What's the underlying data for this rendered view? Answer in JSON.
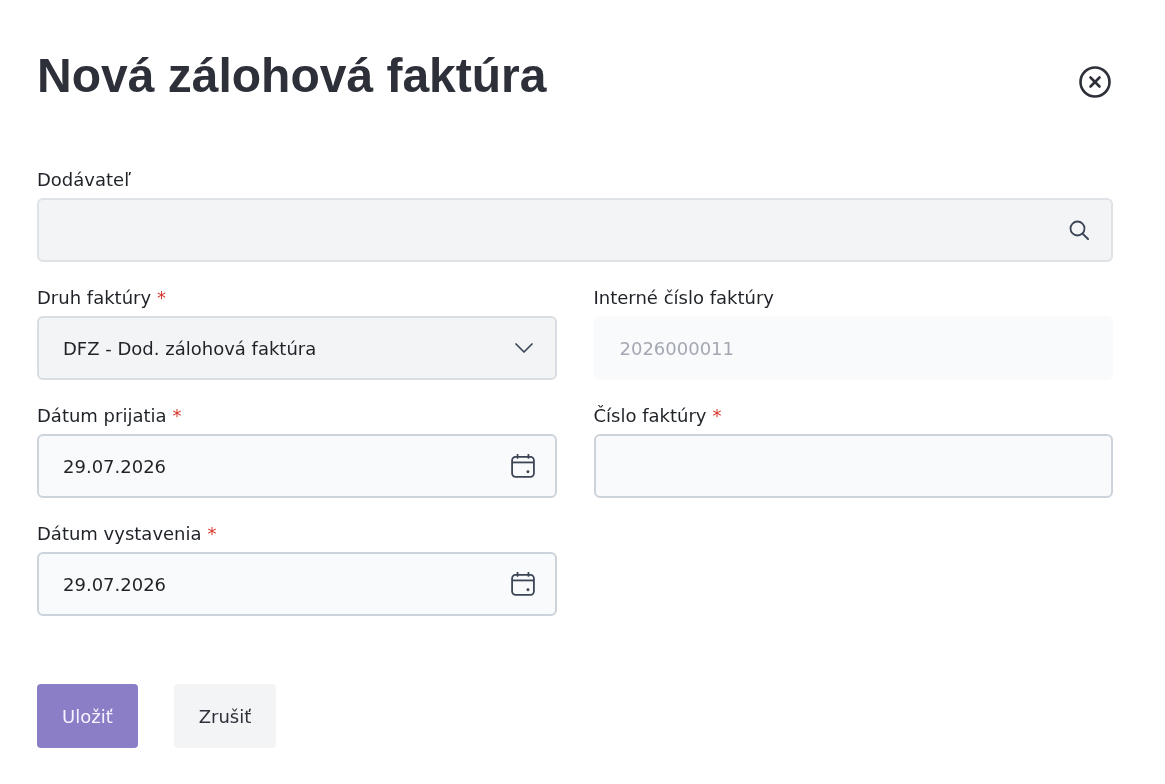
{
  "dialog": {
    "title": "Nová zálohová faktúra",
    "fields": [
      {
        "kind": "search",
        "label": "Dodávateľ",
        "disabled": false
      },
      {
        "kind": "select",
        "label": "Druh faktúry",
        "required_mark": "*",
        "value": "DFZ - Dod. zálohová faktúra",
        "disabled": false
      },
      {
        "kind": "text",
        "label": "Interné číslo faktúry",
        "value": "2026000011",
        "disabled": true
      },
      {
        "kind": "date",
        "label": "Dátum prijatia",
        "required_mark": "*",
        "value": "29.07.2026",
        "disabled": false
      },
      {
        "kind": "text",
        "label": "Číslo faktúry",
        "required_mark": "*",
        "disabled": false
      },
      {
        "kind": "date",
        "label": "Dátum vystavenia",
        "required_mark": "*",
        "value": "29.07.2026",
        "disabled": false
      }
    ],
    "buttons": [
      {
        "kind": "primary",
        "label": "Uložiť"
      },
      {
        "kind": "secondary",
        "label": "Zrušiť"
      }
    ]
  }
}
